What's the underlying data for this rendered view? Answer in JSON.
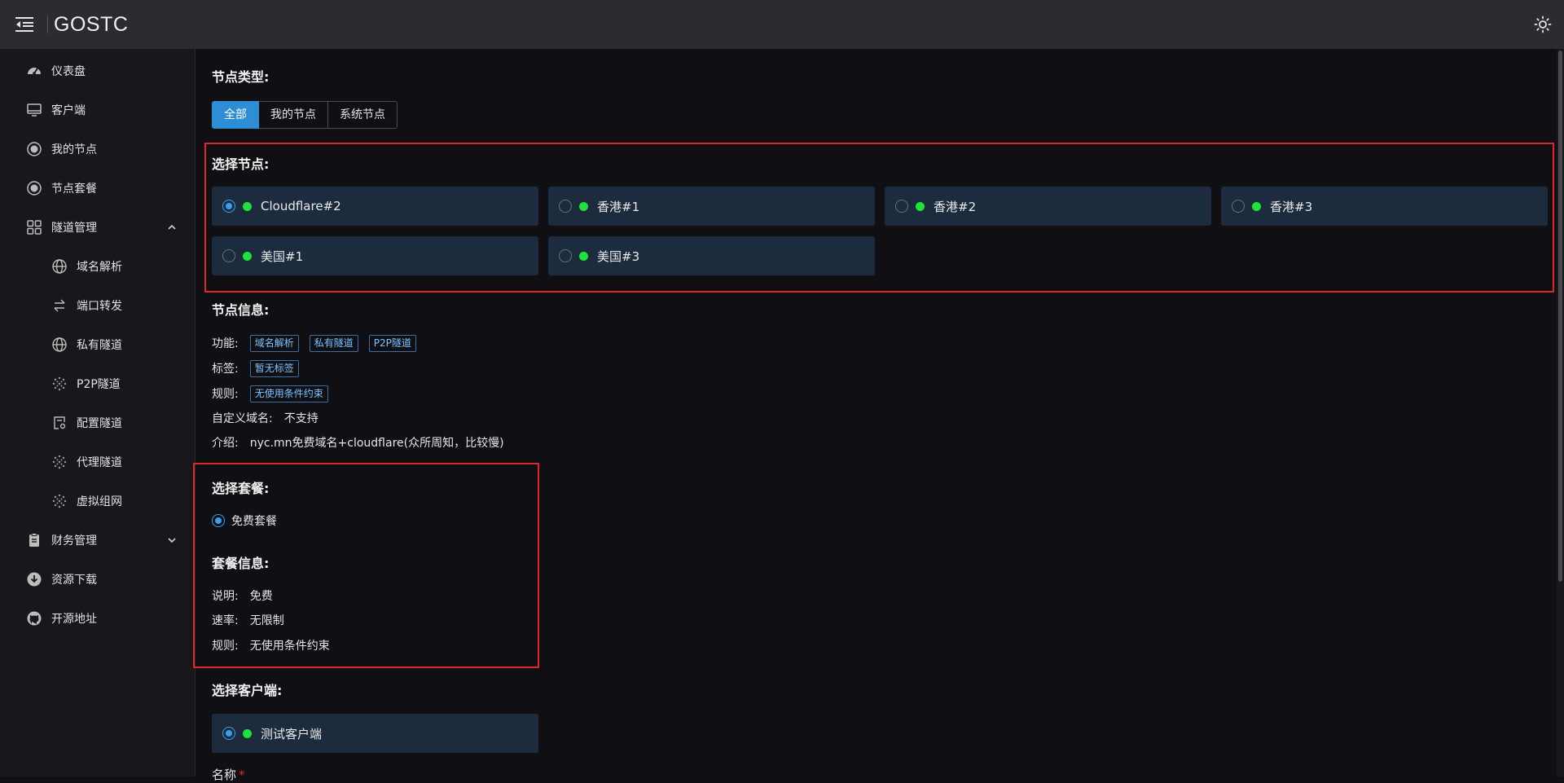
{
  "app": {
    "title": "GOSTC"
  },
  "sidebar": {
    "items": [
      {
        "label": "仪表盘",
        "icon": "dashboard-icon"
      },
      {
        "label": "客户端",
        "icon": "monitor-icon"
      },
      {
        "label": "我的节点",
        "icon": "node-icon"
      },
      {
        "label": "节点套餐",
        "icon": "node-icon"
      },
      {
        "label": "隧道管理",
        "icon": "grid-icon",
        "expanded": true
      },
      {
        "label": "域名解析",
        "icon": "globe-icon"
      },
      {
        "label": "端口转发",
        "icon": "swap-icon"
      },
      {
        "label": "私有隧道",
        "icon": "globe-icon"
      },
      {
        "label": "P2P隧道",
        "icon": "dots-icon"
      },
      {
        "label": "配置隧道",
        "icon": "config-icon"
      },
      {
        "label": "代理隧道",
        "icon": "dots-icon"
      },
      {
        "label": "虚拟组网",
        "icon": "dots-icon"
      },
      {
        "label": "财务管理",
        "icon": "clipboard-icon",
        "expanded": false
      },
      {
        "label": "资源下载",
        "icon": "download-icon"
      },
      {
        "label": "开源地址",
        "icon": "github-icon"
      }
    ]
  },
  "node_type": {
    "heading": "节点类型:",
    "options": [
      "全部",
      "我的节点",
      "系统节点"
    ],
    "selected": "全部"
  },
  "node_select": {
    "heading": "选择节点:",
    "nodes": [
      {
        "name": "Cloudflare#2",
        "selected": true,
        "online": true
      },
      {
        "name": "香港#1",
        "selected": false,
        "online": true
      },
      {
        "name": "香港#2",
        "selected": false,
        "online": true
      },
      {
        "name": "香港#3",
        "selected": false,
        "online": true
      },
      {
        "name": "美国#1",
        "selected": false,
        "online": true
      },
      {
        "name": "美国#3",
        "selected": false,
        "online": true
      }
    ]
  },
  "node_info": {
    "heading": "节点信息:",
    "features_label": "功能:",
    "features": [
      "域名解析",
      "私有隧道",
      "P2P隧道"
    ],
    "tags_label": "标签:",
    "tags": [
      "暂无标签"
    ],
    "rules_label": "规则:",
    "rules": [
      "无使用条件约束"
    ],
    "custom_domain_label": "自定义域名:",
    "custom_domain_value": "不支持",
    "intro_label": "介绍:",
    "intro_value": "nyc.mn免费域名+cloudflare(众所周知，比较慢)"
  },
  "package_select": {
    "heading": "选择套餐:",
    "option": "免费套餐",
    "selected": true
  },
  "package_info": {
    "heading": "套餐信息:",
    "desc_label": "说明:",
    "desc_value": "免费",
    "rate_label": "速率:",
    "rate_value": "无限制",
    "rules_label": "规则:",
    "rules_value": "无使用条件约束"
  },
  "client_select": {
    "heading": "选择客户端:",
    "clients": [
      {
        "name": "测试客户端",
        "selected": true,
        "online": true
      }
    ]
  },
  "name_field": {
    "label": "名称",
    "required_mark": "*"
  },
  "colors": {
    "accent": "#2d8ed6",
    "online": "#1ee33a",
    "highlight_box": "#e0262b",
    "card_bg": "#1c2b3d"
  }
}
